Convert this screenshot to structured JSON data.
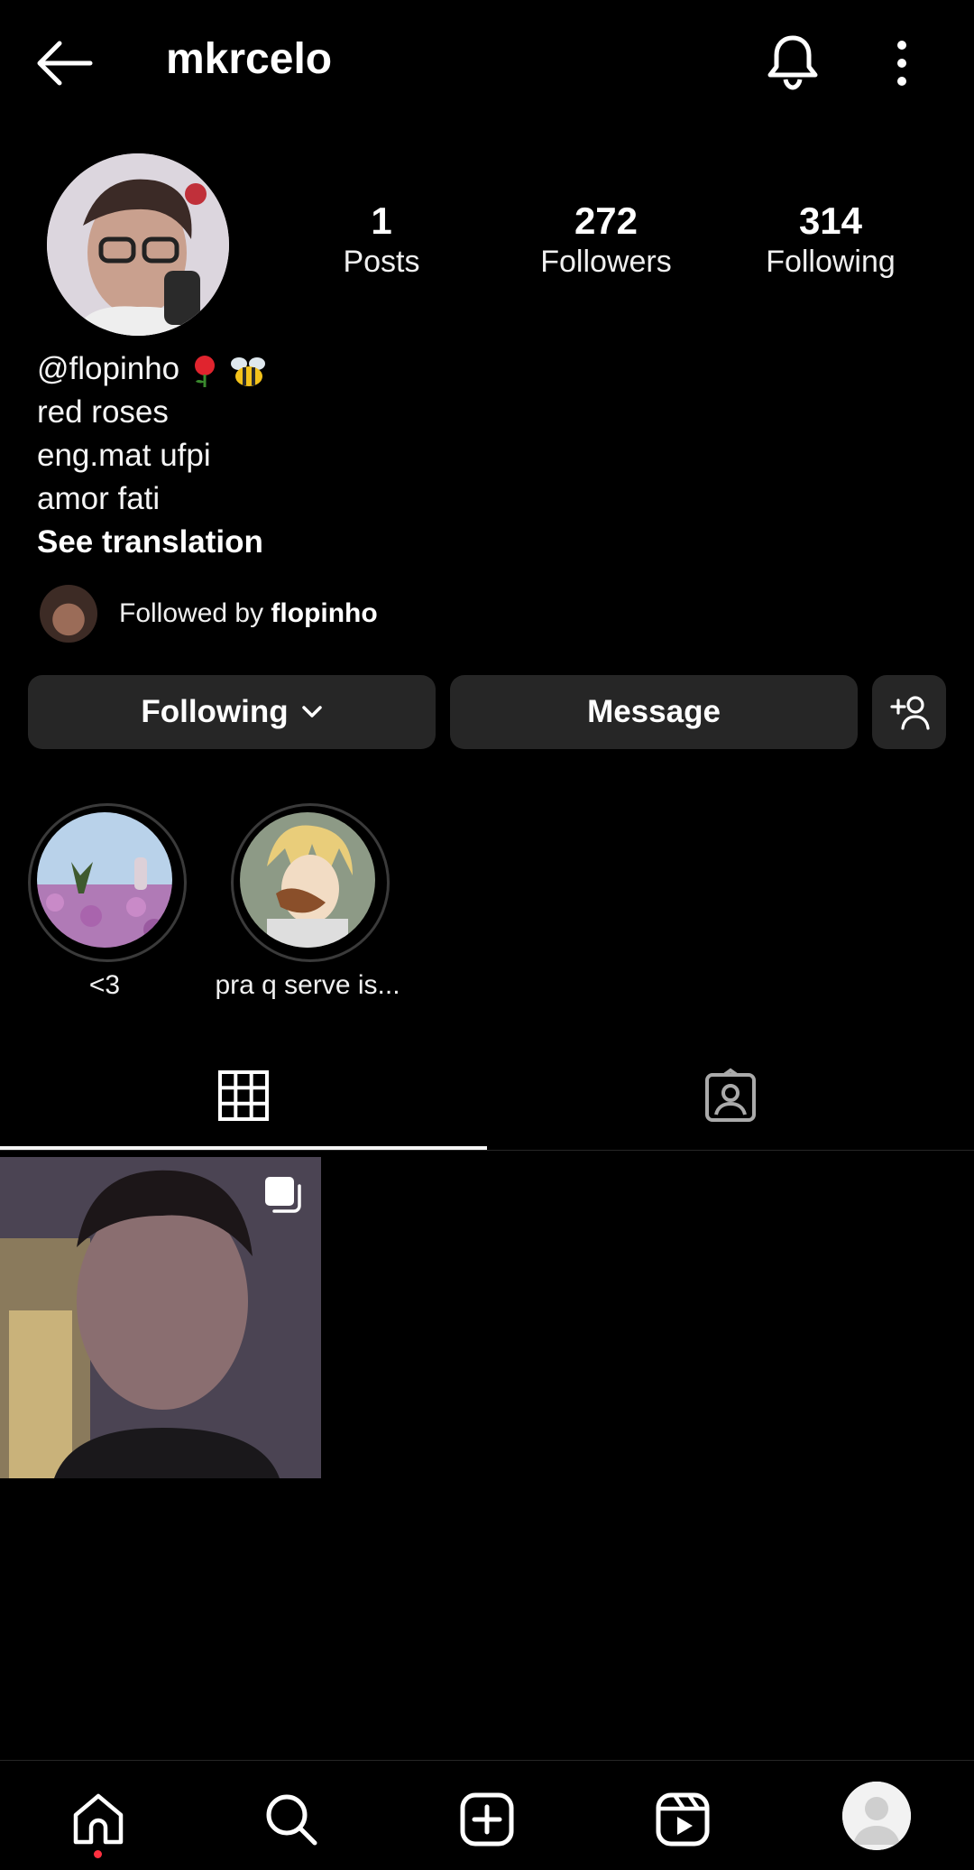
{
  "header": {
    "username": "mkrcelo"
  },
  "stats": [
    {
      "value": "1",
      "label": "Posts"
    },
    {
      "value": "272",
      "label": "Followers"
    },
    {
      "value": "314",
      "label": "Following"
    }
  ],
  "bio": {
    "line1": "@flopinho",
    "line2": "red roses",
    "line3": "eng.mat ufpi",
    "line4": "amor fati",
    "see_translation": "See translation"
  },
  "followed_by": {
    "prefix": "Followed by ",
    "name": "flopinho"
  },
  "buttons": {
    "following": "Following",
    "message": "Message"
  },
  "highlights": [
    {
      "label": "<3"
    },
    {
      "label": "pra q serve is..."
    }
  ],
  "colors": {
    "background": "#000000",
    "button": "#262626",
    "notification_dot": "#ff3040"
  }
}
